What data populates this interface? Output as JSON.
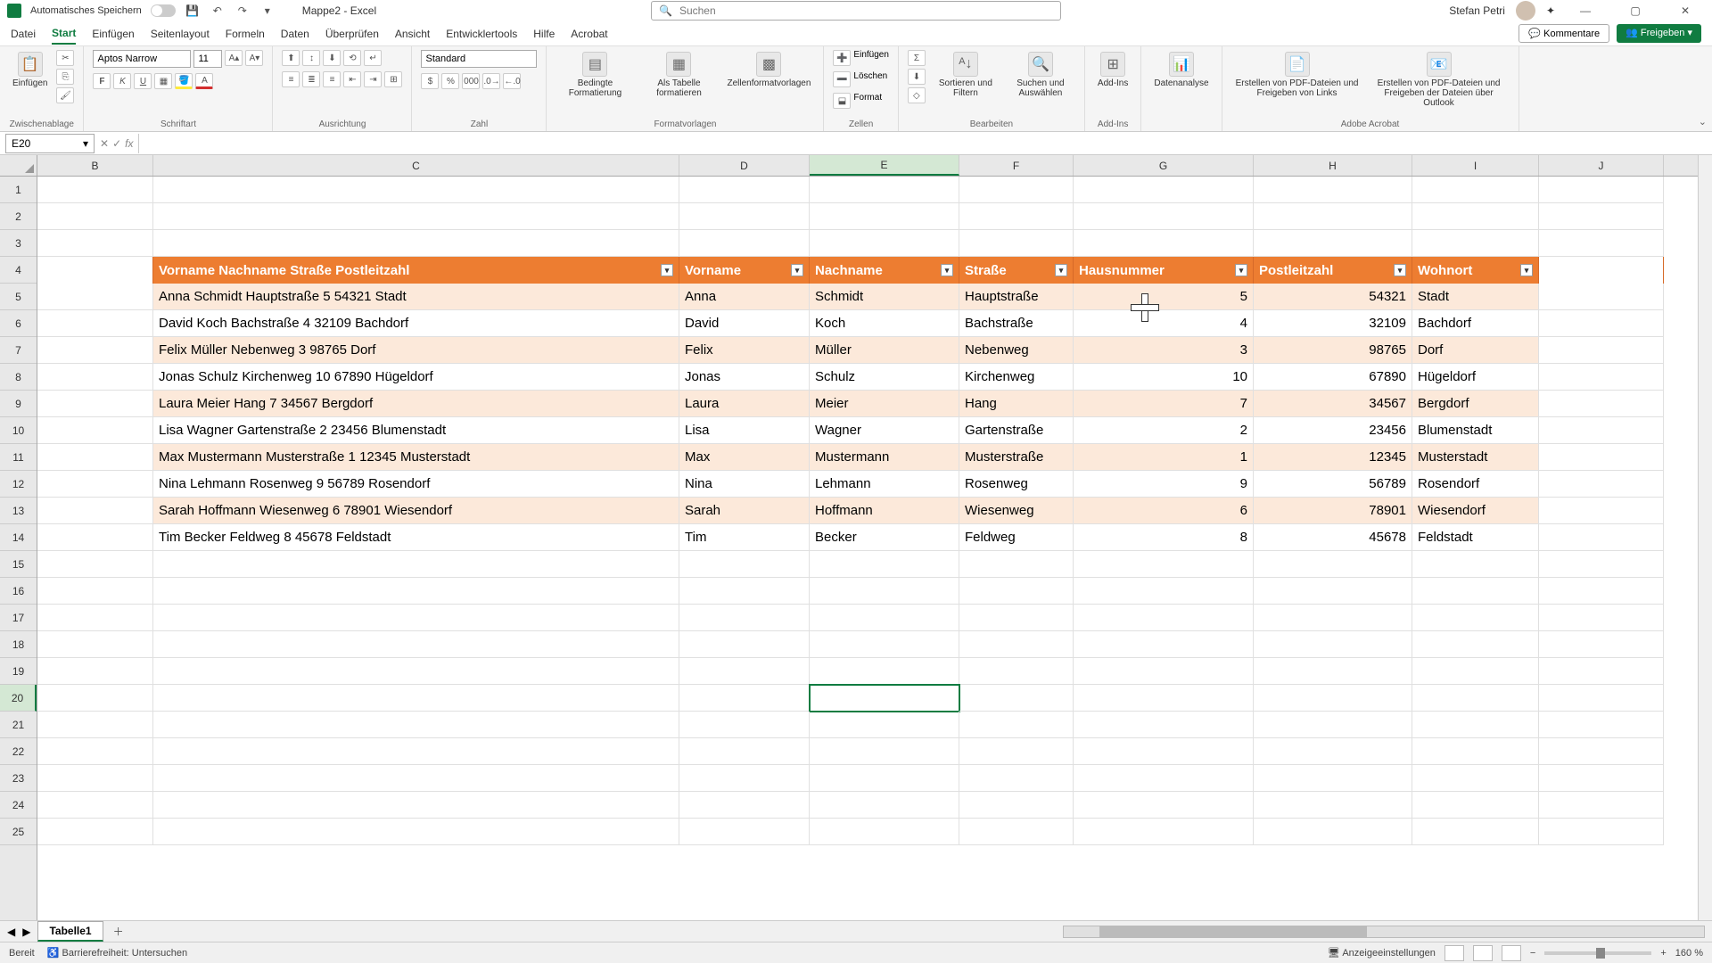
{
  "title": {
    "autosave": "Automatisches Speichern",
    "doc": "Mappe2 - Excel",
    "search_placeholder": "Suchen",
    "user": "Stefan Petri"
  },
  "tabs": {
    "file": "Datei",
    "home": "Start",
    "insert": "Einfügen",
    "layout": "Seitenlayout",
    "formulas": "Formeln",
    "data": "Daten",
    "review": "Überprüfen",
    "view": "Ansicht",
    "dev": "Entwicklertools",
    "help": "Hilfe",
    "acrobat": "Acrobat",
    "comments": "Kommentare",
    "share": "Freigeben"
  },
  "ribbon": {
    "clipboard": {
      "paste": "Einfügen",
      "label": "Zwischenablage"
    },
    "font": {
      "name": "Aptos Narrow",
      "size": "11",
      "label": "Schriftart"
    },
    "align": {
      "label": "Ausrichtung"
    },
    "number": {
      "format": "Standard",
      "label": "Zahl"
    },
    "styles": {
      "cond": "Bedingte Formatierung",
      "table": "Als Tabelle formatieren",
      "cell": "Zellenformatvorlagen",
      "label": "Formatvorlagen"
    },
    "cells": {
      "insert": "Einfügen",
      "delete": "Löschen",
      "format": "Format",
      "label": "Zellen"
    },
    "editing": {
      "sort": "Sortieren und Filtern",
      "find": "Suchen und Auswählen",
      "label": "Bearbeiten"
    },
    "addins": {
      "addins": "Add-Ins",
      "label": "Add-Ins"
    },
    "analysis": {
      "data": "Datenanalyse"
    },
    "adobe": {
      "pdf": "Erstellen von PDF-Dateien und Freigeben von Links",
      "outlook": "Erstellen von PDF-Dateien und Freigeben der Dateien über Outlook",
      "label": "Adobe Acrobat"
    }
  },
  "namebox": "E20",
  "columns": {
    "B": "B",
    "C": "C",
    "D": "D",
    "E": "E",
    "F": "F",
    "G": "G",
    "H": "H",
    "I": "I",
    "J": "J"
  },
  "col_widths": {
    "B": 130,
    "C": 590,
    "D": 146,
    "E": 168,
    "F": 128,
    "G": 202,
    "H": 178,
    "I": 142,
    "J": 140
  },
  "headers": {
    "combined": "Vorname Nachname Straße Postleitzahl",
    "vorname": "Vorname",
    "nachname": "Nachname",
    "strasse": "Straße",
    "hausnr": "Hausnummer",
    "plz": "Postleitzahl",
    "wohnort": "Wohnort"
  },
  "rows": [
    {
      "c": "Anna Schmidt Hauptstraße 5 54321 Stadt",
      "d": "Anna",
      "e": "Schmidt",
      "f": "Hauptstraße",
      "g": "5",
      "h": "54321",
      "i": "Stadt"
    },
    {
      "c": "David Koch Bachstraße 4 32109 Bachdorf",
      "d": "David",
      "e": "Koch",
      "f": "Bachstraße",
      "g": "4",
      "h": "32109",
      "i": "Bachdorf"
    },
    {
      "c": "Felix Müller Nebenweg 3 98765 Dorf",
      "d": "Felix",
      "e": "Müller",
      "f": "Nebenweg",
      "g": "3",
      "h": "98765",
      "i": "Dorf"
    },
    {
      "c": "Jonas Schulz Kirchenweg 10 67890 Hügeldorf",
      "d": "Jonas",
      "e": "Schulz",
      "f": "Kirchenweg",
      "g": "10",
      "h": "67890",
      "i": "Hügeldorf"
    },
    {
      "c": "Laura Meier Hang 7 34567 Bergdorf",
      "d": "Laura",
      "e": "Meier",
      "f": "Hang",
      "g": "7",
      "h": "34567",
      "i": "Bergdorf"
    },
    {
      "c": "Lisa Wagner Gartenstraße 2 23456 Blumenstadt",
      "d": "Lisa",
      "e": "Wagner",
      "f": "Gartenstraße",
      "g": "2",
      "h": "23456",
      "i": "Blumenstadt"
    },
    {
      "c": "Max Mustermann Musterstraße 1 12345 Musterstadt",
      "d": "Max",
      "e": "Mustermann",
      "f": "Musterstraße",
      "g": "1",
      "h": "12345",
      "i": "Musterstadt"
    },
    {
      "c": "Nina Lehmann Rosenweg 9 56789 Rosendorf",
      "d": "Nina",
      "e": "Lehmann",
      "f": "Rosenweg",
      "g": "9",
      "h": "56789",
      "i": "Rosendorf"
    },
    {
      "c": "Sarah Hoffmann Wiesenweg 6 78901 Wiesendorf",
      "d": "Sarah",
      "e": "Hoffmann",
      "f": "Wiesenweg",
      "g": "6",
      "h": "78901",
      "i": "Wiesendorf"
    },
    {
      "c": "Tim Becker Feldweg 8 45678 Feldstadt",
      "d": "Tim",
      "e": "Becker",
      "f": "Feldweg",
      "g": "8",
      "h": "45678",
      "i": "Feldstadt"
    }
  ],
  "sheet": {
    "tab1": "Tabelle1"
  },
  "status": {
    "ready": "Bereit",
    "access": "Barrierefreiheit: Untersuchen",
    "display": "Anzeigeeinstellungen",
    "zoom": "160 %"
  }
}
